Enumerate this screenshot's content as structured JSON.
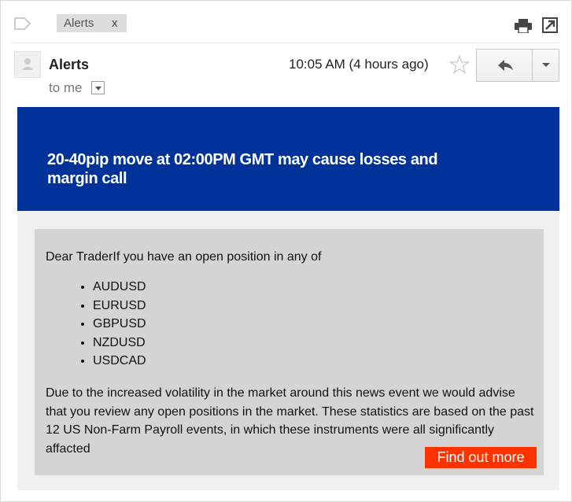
{
  "labels": {
    "chip_text": "Alerts",
    "chip_close": "x",
    "icons": [
      "label-tag-icon",
      "print-icon",
      "popout-icon"
    ]
  },
  "header": {
    "sender": "Alerts",
    "recipient": "to me",
    "timestamp": "10:05 AM (4 hours ago)",
    "icons": [
      "avatar-icon",
      "star-icon",
      "reply-icon",
      "chevron-down-icon"
    ]
  },
  "email": {
    "banner_headline": "20-40pip move at 02:00PM GMT may cause losses and margin call",
    "greeting": "Dear TraderIf you have an open position in any of",
    "instruments": [
      "AUDUSD",
      "EURUSD",
      "GBPUSD",
      "NZDUSD",
      "USDCAD"
    ],
    "disclaimer": "Due to the increased volatility in the market around this news event we would advise that you review any open positions in the market. These statistics are based on the past 12 US Non-Farm Payroll events, in which these instruments were all significantly affacted",
    "cta_label": "Find out more"
  },
  "colors": {
    "banner": "#003399",
    "card": "#d4d4d4",
    "cta": "#ff3300"
  }
}
